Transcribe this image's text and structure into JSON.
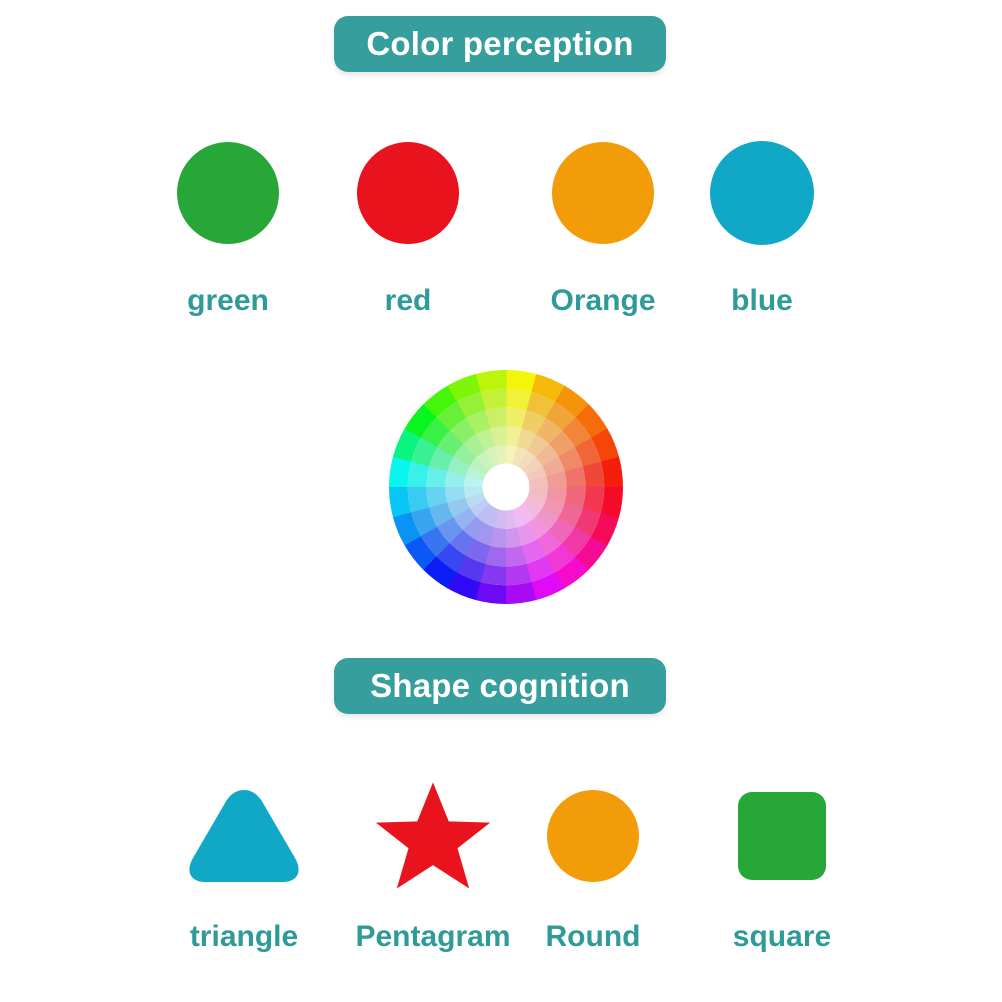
{
  "page": {
    "background": "#ffffff",
    "accent_teal": "#369e9c",
    "caption_color": "#2f9b98"
  },
  "sections": [
    {
      "id": "color-perception",
      "banner_label": "Color perception",
      "items": [
        {
          "label": "green",
          "icon": "filled-circle-icon",
          "color": "#27a737"
        },
        {
          "label": "red",
          "icon": "filled-circle-icon",
          "color": "#e8131c"
        },
        {
          "label": "Orange",
          "icon": "filled-circle-icon",
          "color": "#f29c09"
        },
        {
          "label": "blue",
          "icon": "filled-circle-icon",
          "color": "#11a8c8"
        }
      ]
    },
    {
      "id": "shape-cognition",
      "banner_label": "Shape cognition",
      "items": [
        {
          "label": "triangle",
          "icon": "rounded-triangle-icon",
          "color": "#11a8c8"
        },
        {
          "label": "Pentagram",
          "icon": "five-point-star-icon",
          "color": "#e8131c"
        },
        {
          "label": "Round",
          "icon": "filled-circle-icon",
          "color": "#f29c09"
        },
        {
          "label": "square",
          "icon": "rounded-square-icon",
          "color": "#27a737"
        }
      ]
    }
  ],
  "color_wheel": {
    "icon": "color-wheel-icon",
    "sectors": 24,
    "rings": 5,
    "center_hole": true,
    "hub_color": "#ffffff",
    "hues": [
      60,
      45,
      35,
      25,
      15,
      5,
      352,
      340,
      325,
      310,
      295,
      280,
      265,
      250,
      235,
      220,
      205,
      192,
      178,
      150,
      125,
      105,
      90,
      75
    ],
    "ring_tints": [
      0.0,
      0.18,
      0.38,
      0.58,
      0.76
    ]
  }
}
